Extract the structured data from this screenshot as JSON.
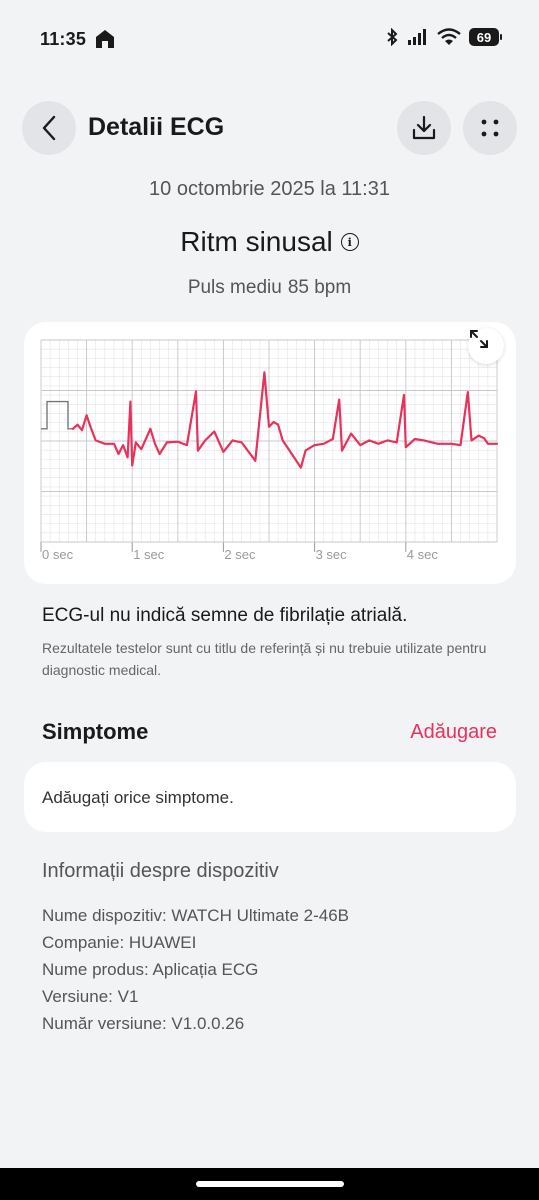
{
  "status": {
    "time": "11:35",
    "battery": "69"
  },
  "header": {
    "title": "Detalii ECG"
  },
  "record": {
    "datetime": "10 octombrie 2025 la 11:31",
    "rhythm": "Ritm sinusal",
    "pulse_label": "Puls mediu",
    "pulse_value": "85 bpm"
  },
  "chart_data": {
    "type": "line",
    "title": "",
    "xlabel": "",
    "ylabel": "",
    "x_ticks": [
      "0 sec",
      "1 sec",
      "2 sec",
      "3 sec",
      "4 sec"
    ],
    "xlim": [
      0,
      5
    ],
    "grid": true,
    "series": [
      {
        "color": "#e8315b",
        "r_peaks_sec": [
          0.98,
          1.7,
          2.45,
          3.27,
          3.98,
          4.68
        ],
        "values": [
          [
            0.35,
            0.12
          ],
          [
            0.4,
            0.18
          ],
          [
            0.45,
            0.1
          ],
          [
            0.5,
            0.32
          ],
          [
            0.54,
            0.16
          ],
          [
            0.6,
            -0.05
          ],
          [
            0.7,
            -0.1
          ],
          [
            0.8,
            -0.1
          ],
          [
            0.85,
            -0.25
          ],
          [
            0.9,
            -0.12
          ],
          [
            0.95,
            -0.3
          ],
          [
            0.98,
            0.52
          ],
          [
            1.0,
            -0.42
          ],
          [
            1.04,
            -0.08
          ],
          [
            1.1,
            -0.18
          ],
          [
            1.2,
            0.12
          ],
          [
            1.25,
            -0.1
          ],
          [
            1.3,
            -0.25
          ],
          [
            1.38,
            -0.08
          ],
          [
            1.5,
            -0.07
          ],
          [
            1.6,
            -0.12
          ],
          [
            1.7,
            0.67
          ],
          [
            1.72,
            -0.2
          ],
          [
            1.8,
            -0.05
          ],
          [
            1.9,
            0.08
          ],
          [
            2.0,
            -0.22
          ],
          [
            2.1,
            -0.05
          ],
          [
            2.2,
            -0.08
          ],
          [
            2.35,
            -0.35
          ],
          [
            2.45,
            0.95
          ],
          [
            2.5,
            0.15
          ],
          [
            2.55,
            0.22
          ],
          [
            2.6,
            0.18
          ],
          [
            2.65,
            -0.05
          ],
          [
            2.75,
            -0.25
          ],
          [
            2.85,
            -0.45
          ],
          [
            2.9,
            -0.2
          ],
          [
            3.0,
            -0.12
          ],
          [
            3.1,
            -0.1
          ],
          [
            3.2,
            -0.03
          ],
          [
            3.27,
            0.55
          ],
          [
            3.3,
            -0.2
          ],
          [
            3.4,
            0.05
          ],
          [
            3.5,
            -0.12
          ],
          [
            3.6,
            -0.05
          ],
          [
            3.7,
            -0.1
          ],
          [
            3.8,
            -0.05
          ],
          [
            3.9,
            -0.08
          ],
          [
            3.98,
            0.62
          ],
          [
            4.0,
            -0.15
          ],
          [
            4.1,
            -0.03
          ],
          [
            4.2,
            -0.05
          ],
          [
            4.35,
            -0.1
          ],
          [
            4.5,
            -0.1
          ],
          [
            4.6,
            -0.12
          ],
          [
            4.68,
            0.66
          ],
          [
            4.72,
            -0.05
          ],
          [
            4.8,
            0.02
          ],
          [
            4.86,
            -0.02
          ],
          [
            4.9,
            -0.1
          ],
          [
            5.0,
            -0.1
          ]
        ]
      }
    ]
  },
  "result": {
    "headline": "ECG-ul nu indică semne de fibrilație atrială.",
    "disclaimer": "Rezultatele testelor sunt cu titlu de referință și nu trebuie utilizate pentru diagnostic medical."
  },
  "symptoms": {
    "title": "Simptome",
    "add_label": "Adăugare",
    "placeholder": "Adăugați orice simptome."
  },
  "device": {
    "title": "Informații despre dispozitiv",
    "lines": [
      "Nume dispozitiv: WATCH Ultimate 2-46B",
      "Companie: HUAWEI",
      "Nume produs: Aplicația ECG",
      "Versiune: V1",
      "Număr versiune: V1.0.0.26"
    ]
  },
  "icons": {
    "back": "chevron-left-icon",
    "download": "download-icon",
    "more": "more-dots-icon",
    "info": "info-icon",
    "expand": "expand-icon"
  }
}
